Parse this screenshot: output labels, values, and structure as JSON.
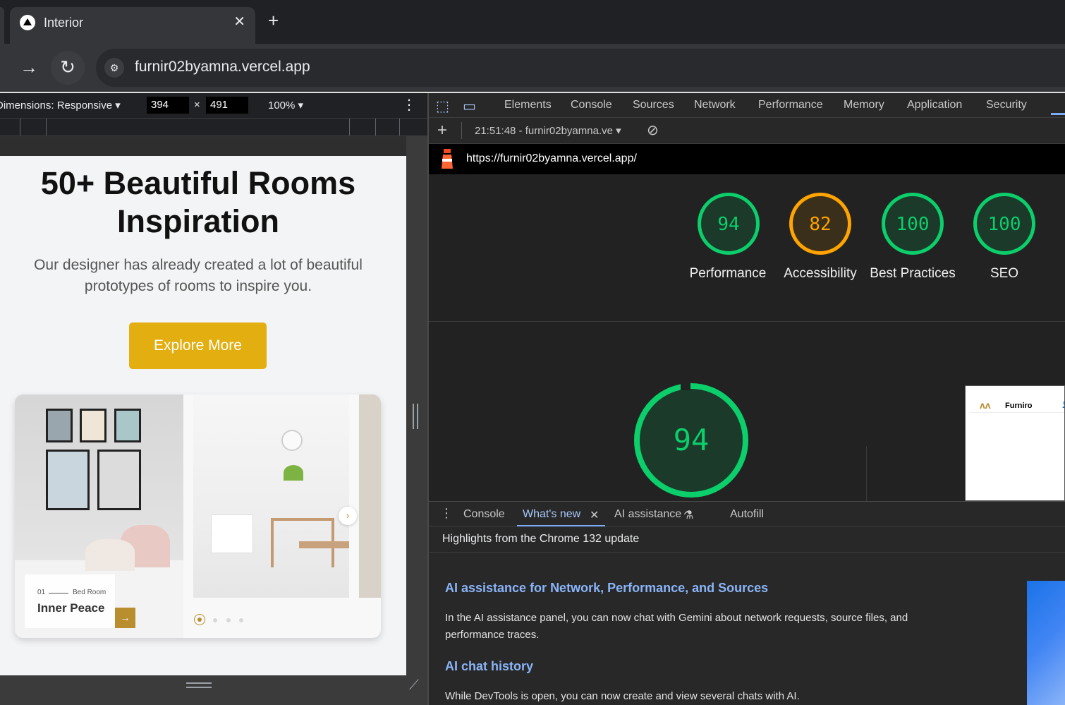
{
  "browser": {
    "tab_title": "Interior",
    "tab_close": "✕",
    "new_tab": "+",
    "address": "furnir02byamna.vercel.app"
  },
  "device_toolbar": {
    "dimensions_label": "Dimensions: Responsive ▾",
    "width": "394",
    "times": "×",
    "height": "491",
    "zoom": "100% ▾"
  },
  "page": {
    "hero_title_line1": "50+ Beautiful Rooms",
    "hero_title_line2": "Inspiration",
    "hero_subtitle": "Our designer has already created a lot of beautiful prototypes of rooms to inspire you.",
    "cta_label": "Explore More",
    "slide_number": "01",
    "slide_category": "Bed Room",
    "slide_name": "Inner Peace",
    "accent_color": "#b88e2f",
    "cta_color": "#e3ae10"
  },
  "devtools": {
    "tabs": [
      "Elements",
      "Console",
      "Sources",
      "Network",
      "Performance",
      "Memory",
      "Application",
      "Security"
    ],
    "report_selector": "21:51:48 - furnir02byamna.ve ▾",
    "report_url": "https://furnir02byamna.vercel.app/",
    "scores": [
      {
        "label": "Performance",
        "value": "94",
        "color": "#0cce6b"
      },
      {
        "label": "Accessibility",
        "value": "82",
        "color": "#ffa400"
      },
      {
        "label": "Best Practices",
        "value": "100",
        "color": "#0cce6b"
      },
      {
        "label": "SEO",
        "value": "100",
        "color": "#0cce6b"
      }
    ],
    "big_score": "94",
    "thumbnail_brand": "Furniro"
  },
  "drawer": {
    "tabs": [
      "Console",
      "What's new",
      "AI assistance",
      "Autofill"
    ],
    "active_tab": "What's new",
    "heading": "Highlights from the Chrome 132 update",
    "sections": [
      {
        "title": "AI assistance for Network, Performance, and Sources",
        "body": "In the AI assistance panel, you can now chat with Gemini about network requests, source files, and performance traces."
      },
      {
        "title": "AI chat history",
        "body": "While DevTools is open, you can now create and view several chats with AI."
      }
    ]
  }
}
